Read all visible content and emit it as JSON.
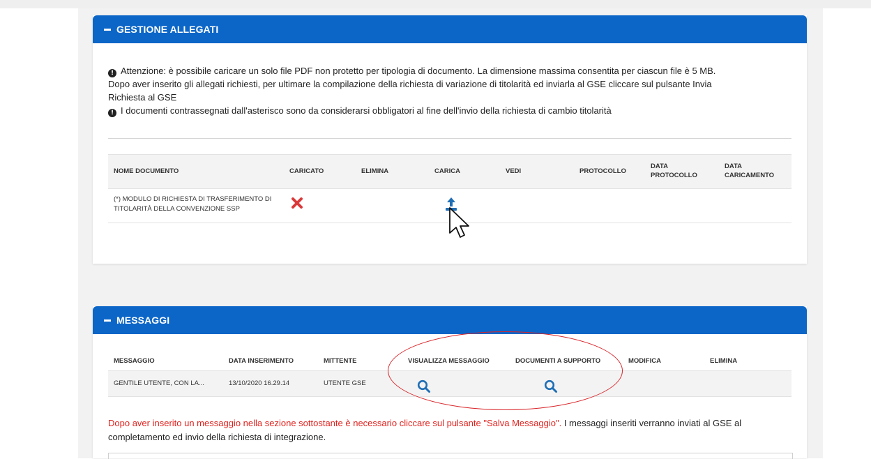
{
  "allegati": {
    "title": "GESTIONE ALLEGATI",
    "info_line1": "Attenzione: è possibile caricare un solo file PDF non protetto per tipologia di documento. La dimensione massima consentita per ciascun file è 5 MB.",
    "info_line2": "Dopo aver inserito gli allegati richiesti, per ultimare la compilazione della richiesta di variazione di titolarità ed inviarla al GSE cliccare sul pulsante Invia",
    "info_line3": "Richiesta al GSE",
    "info_line4": "I documenti contrassegnati dall'asterisco sono da considerarsi obbligatori al fine dell'invio della richiesta di cambio titolarità",
    "columns": {
      "nome": "NOME DOCUMENTO",
      "caricato": "CARICATO",
      "elimina": "ELIMINA",
      "carica": "CARICA",
      "vedi": "VEDI",
      "protocollo": "PROTOCOLLO",
      "data_protocollo_1": "DATA",
      "data_protocollo_2": "PROTOCOLLO",
      "data_caricamento_1": "DATA",
      "data_caricamento_2": "CARICAMENTO"
    },
    "rows": [
      {
        "nome_line1": "(*) MODULO DI RICHIESTA DI TRASFERIMENTO DI",
        "nome_line2": "TITOLARITÀ DELLA CONVENZIONE SSP",
        "caricato_icon": "x-icon",
        "carica_icon": "upload-icon"
      }
    ]
  },
  "messaggi": {
    "title": "MESSAGGI",
    "columns": {
      "messaggio": "MESSAGGIO",
      "data_inserimento": "DATA INSERIMENTO",
      "mittente": "MITTENTE",
      "visualizza": "VISUALIZZA MESSAGGIO",
      "documenti": "DOCUMENTI A SUPPORTO",
      "modifica": "MODIFICA",
      "elimina": "ELIMINA"
    },
    "rows": [
      {
        "messaggio": "GENTILE UTENTE, CON LA...",
        "data_inserimento": "13/10/2020 16.29.14",
        "mittente": "UTENTE GSE",
        "visualizza_icon": "search-icon",
        "documenti_icon": "search-icon"
      }
    ],
    "note_red": "Dopo aver inserito un messaggio nella sezione sottostante è necessario cliccare sul pulsante \"Salva Messaggio\".",
    "note_black_1": " I messaggi inseriti verranno inviati al GSE al",
    "note_black_2": "completamento ed invio della richiesta di integrazione."
  },
  "colors": {
    "header_blue": "#0b66c8",
    "accent_red": "#e0231f",
    "x_red": "#d9393a",
    "icon_blue": "#1f6fb5"
  }
}
